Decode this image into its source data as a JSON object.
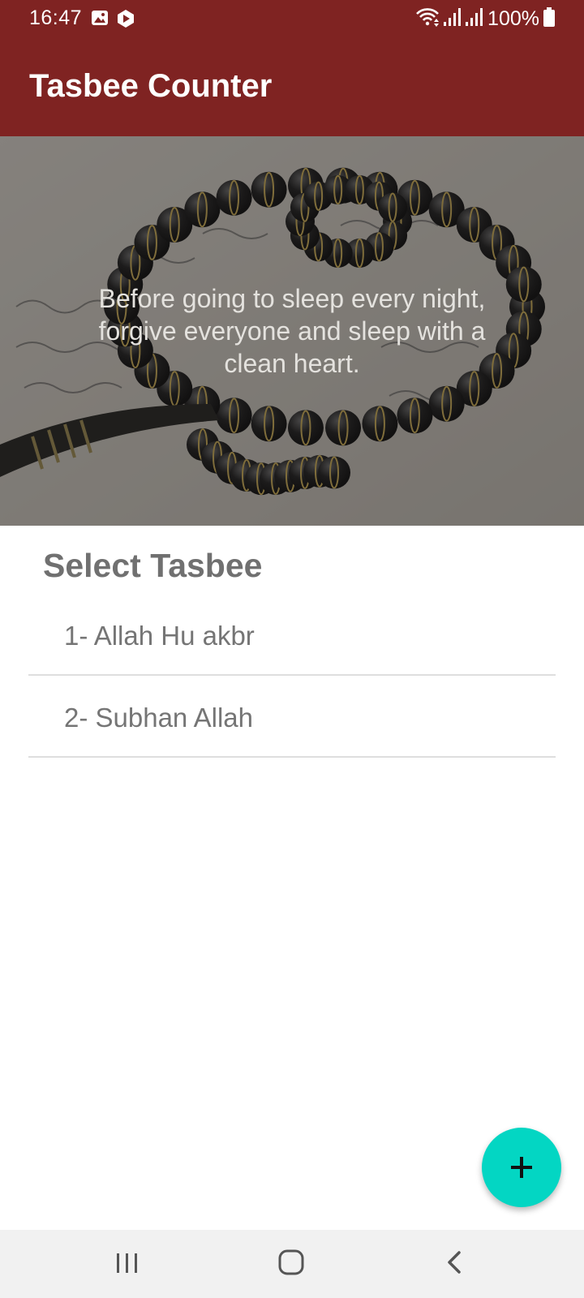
{
  "status_bar": {
    "time": "16:47",
    "battery": "100%",
    "icons": [
      "gallery-icon",
      "media-icon",
      "wifi-icon",
      "signal-icon",
      "signal-icon",
      "battery-icon"
    ]
  },
  "app_bar": {
    "title": "Tasbee Counter",
    "color": "#7f2322"
  },
  "banner": {
    "quote": "Before going to sleep every night, forgive everyone and sleep with a clean heart."
  },
  "main": {
    "section_title": "Select Tasbee",
    "items": [
      {
        "label": "1- Allah Hu akbr"
      },
      {
        "label": "2- Subhan Allah"
      }
    ]
  },
  "fab": {
    "icon": "plus-icon",
    "color": "#03d6c3"
  },
  "nav_bar": {
    "buttons": [
      "recent-apps-icon",
      "home-icon",
      "back-icon"
    ]
  }
}
